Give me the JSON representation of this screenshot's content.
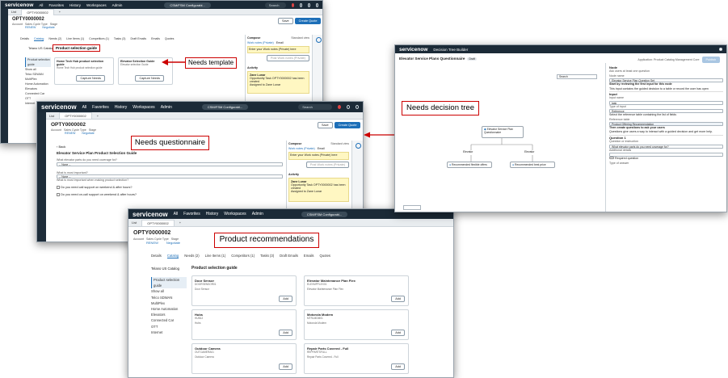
{
  "nav": {
    "logo": "servicenow",
    "items": [
      "All",
      "Favorites",
      "History",
      "Workspaces",
      "Admin"
    ],
    "app_pill": "CSM/FSM Configurabl...",
    "search": "Search"
  },
  "record": {
    "tab_list": "List",
    "tab_record": "OPTY0000002",
    "number": "OPTY0000002",
    "account_label": "Account",
    "sales_cycle_label": "Sales Cycle Type",
    "stage_label": "Stage",
    "stage_value": "RENEW",
    "cycle_value": "Negotiate",
    "save": "Save",
    "create_quote": "Create Quote",
    "subtabs": [
      "Details",
      "Catalog",
      "Needs (2)",
      "Line Items (1)",
      "Competitors (1)",
      "Tasks (3)",
      "Draft Emails",
      "Emails",
      "Quotes"
    ]
  },
  "catalog": {
    "selector": "Telano US Catalog",
    "heading": "Product selection guide",
    "side_items": [
      "Product selection guide",
      "Show all",
      "Telco SDWAN",
      "MultiPlex",
      "Home Automation",
      "Elevators",
      "Connected Car",
      "OTT",
      "Internet"
    ]
  },
  "s1": {
    "guide_card_1_title": "Home Tech Hub product selection guide",
    "guide_card_1_sub": "Home Tech Hub product selection guide",
    "guide_card_2_title": "Elevator Selection Guide",
    "guide_card_2_sub": "Elevator selection Guide",
    "capture_needs": "Capture Needs"
  },
  "composer": {
    "title": "Compose",
    "standard_view": "Standard view",
    "mode": "Work notes (Private)",
    "email": "Email",
    "placeholder": "Enter your Work notes (Private) here",
    "post": "Post Work notes (Private)",
    "activity": "Activity",
    "user": "Zane Lunar",
    "activity_text": "Opportunity Task OPTY0000002 has been created",
    "assigned": "Assigned to Zane Lunar"
  },
  "s2": {
    "back": "Back",
    "form_title": "Elevator Service Plan Product Selection Guide",
    "q1": "What elevator parts do you need coverage for?",
    "q2": "What is most important?",
    "q2_hint": "What is most important when making product selection?",
    "none": "-- None --",
    "cb1": "Do you need call support on weekend & after hours?",
    "cb2": "Do you need on-call support on weekend & after hours?"
  },
  "s3": {
    "products": [
      {
        "name": "Door Sensor",
        "code": "DOORSENSOR01",
        "desc": "Door Sensor"
      },
      {
        "name": "Elevator Maintenance Plan Flex",
        "code": "ELEVMPFLEX01",
        "desc": "Elevator Maintenance Plan Flex"
      },
      {
        "name": "Hubs",
        "code": "HUB12",
        "desc": "Hubs"
      },
      {
        "name": "Motorola Modem",
        "code": "MTRLMDM01",
        "desc": "Motorola Modem"
      },
      {
        "name": "Outdoor Camera",
        "code": "OUTCAMERA01",
        "desc": "Outdoor Camera"
      },
      {
        "name": "Repair Parts Covered - Full",
        "code": "REPPARTSFULL",
        "desc": "Repair Parts Covered - Full"
      }
    ],
    "add": "Add"
  },
  "dt": {
    "logo": "servicenow",
    "app": "Decision Tree Builder",
    "title": "Elevator Service Plans Questionnaire",
    "badge": "Draft",
    "app_scope": "Application: Product Catalog Management Core",
    "publish": "Publish",
    "search": "Search",
    "root": "Elevator Service Plan Questionnaire",
    "branch_left": "Elevator",
    "branch_right": "Elevator",
    "leaf_left": "Recommended flexible offers",
    "leaf_right": "Recommended best price",
    "panel_node": "Node",
    "panel_add": "Ask users at least one question",
    "panel_node_name_label": "Node name",
    "panel_node_name": "Elevator Service Plan Question Set",
    "panel_start": "Start by reviewing the first input for this node",
    "panel_start_desc": "This input contains the guided decision to a table or record the user has open",
    "panel_input": "Input",
    "panel_input_name_label": "Input name",
    "panel_input_name": "task",
    "panel_type_label": "Type of input",
    "panel_type": "Reference",
    "panel_ref_desc": "Select the reference table containing the list of fields",
    "panel_ref_label": "Reference table",
    "panel_ref": "Product Offering Recommendation",
    "panel_create": "Then create questions to ask your users",
    "panel_create_desc": "Questions give users a way to interact with a guided decision and get more help.",
    "panel_q": "Question 1",
    "panel_q_label": "Question or instruction",
    "panel_q_value": "What elevator parts do you need coverage for?",
    "panel_details": "Additional details",
    "panel_required": "Required question",
    "panel_answer": "Type of answer"
  },
  "callouts": {
    "needs_template": "Needs template",
    "needs_questionnaire": "Needs questionnaire",
    "needs_decision_tree": "Needs decision tree",
    "product_recommendations": "Product recommendations"
  }
}
